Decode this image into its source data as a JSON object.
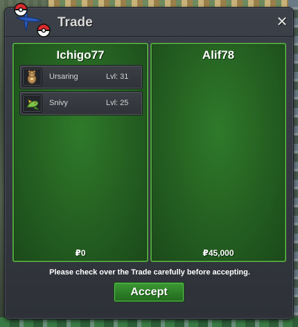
{
  "window": {
    "title": "Trade",
    "close_icon": "close-icon"
  },
  "trade": {
    "left": {
      "name": "Ichigo77",
      "money": "₽0",
      "pokemon": [
        {
          "name": "Ursaring",
          "level": "Lvl: 31",
          "icon": "ursaring-sprite-icon"
        },
        {
          "name": "Snivy",
          "level": "Lvl: 25",
          "icon": "snivy-sprite-icon"
        }
      ]
    },
    "right": {
      "name": "Alif78",
      "money": "₽45,000",
      "pokemon": []
    }
  },
  "footer": {
    "notice": "Please check over the Trade carefully before accepting.",
    "accept_label": "Accept"
  },
  "colors": {
    "panel_green": "#245f21",
    "panel_border": "#4fa53c",
    "window_bg": "#33363d",
    "accept_green": "#2b7a25"
  }
}
